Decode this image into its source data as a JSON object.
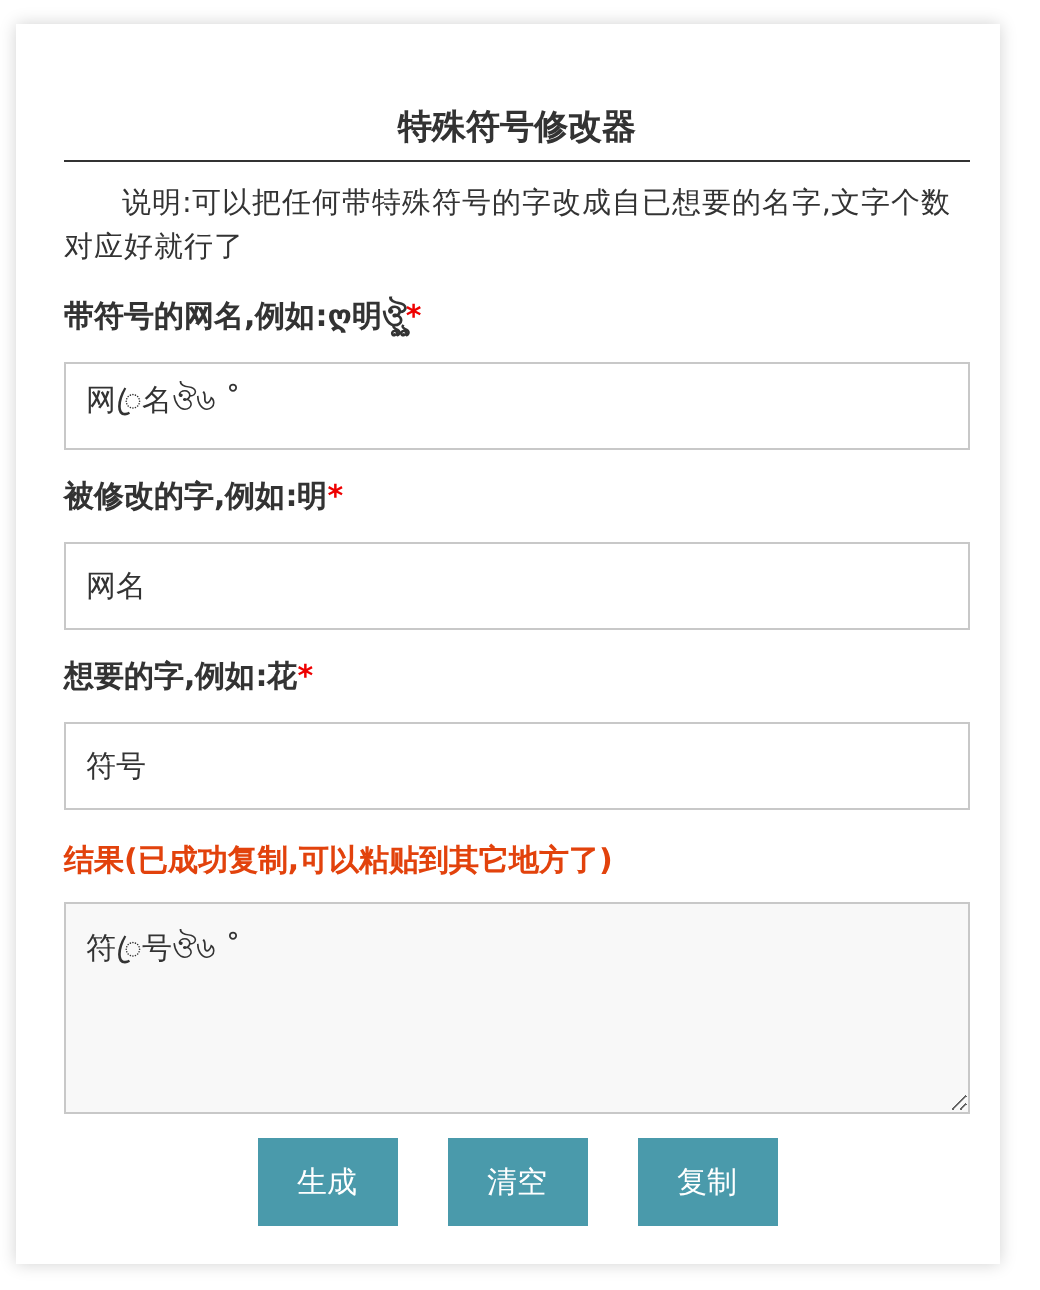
{
  "title": "特殊符号修改器",
  "description": "说明:可以把任何带特殊符号的字改成自已想要的名字,文字个数对应好就行了",
  "fields": [
    {
      "label": "带符号的网名,例如:ღ明ঔৣ",
      "required_mark": "*",
      "value": "网ꦿ名ঔ৬ ˚"
    },
    {
      "label": "被修改的字,例如:明",
      "required_mark": "*",
      "value": "网名"
    },
    {
      "label": "想要的字,例如:花",
      "required_mark": "*",
      "value": "符号"
    }
  ],
  "result": {
    "label": "结果(已成功复制,可以粘贴到其它地方了)",
    "value": "符ꦿ号ঔ৬ ˚"
  },
  "buttons": [
    "生成",
    "清空",
    "复制"
  ]
}
